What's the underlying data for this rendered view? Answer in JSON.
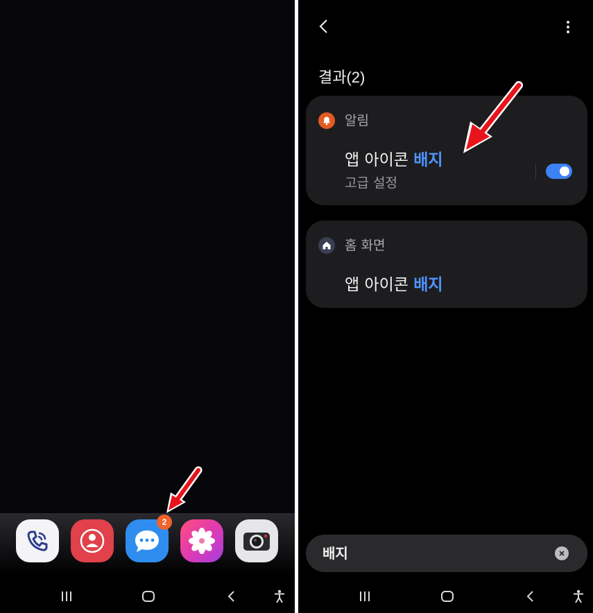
{
  "left_screen": {
    "dock_apps": [
      {
        "name": "phone",
        "icon": "phone-icon"
      },
      {
        "name": "contacts",
        "icon": "person-icon"
      },
      {
        "name": "messages",
        "icon": "chat-bubble-icon"
      },
      {
        "name": "gallery",
        "icon": "flower-icon"
      },
      {
        "name": "camera",
        "icon": "camera-icon"
      }
    ],
    "messages_badge": "2",
    "navbar": [
      "recents-icon",
      "home-icon",
      "back-icon",
      "accessibility-icon"
    ]
  },
  "right_screen": {
    "results_title": "결과(2)",
    "results": [
      {
        "category": "알림",
        "category_icon": "bell-icon",
        "category_color": "#e35b24",
        "title_plain": "앱 아이콘 ",
        "title_highlight": "배지",
        "subtitle": "고급 설정",
        "toggle_on": true
      },
      {
        "category": "홈 화면",
        "category_icon": "house-icon",
        "category_color": "#3a3f52",
        "title_plain": "앱 아이콘 ",
        "title_highlight": "배지"
      }
    ],
    "search": {
      "value": "배지"
    },
    "navbar": [
      "recents-icon",
      "home-icon",
      "back-icon",
      "accessibility-icon"
    ]
  },
  "colors": {
    "highlight": "#4f94ff",
    "toggle": "#3d82f5",
    "badge": "#f0632a",
    "annotation_arrow": "#e8141c"
  }
}
